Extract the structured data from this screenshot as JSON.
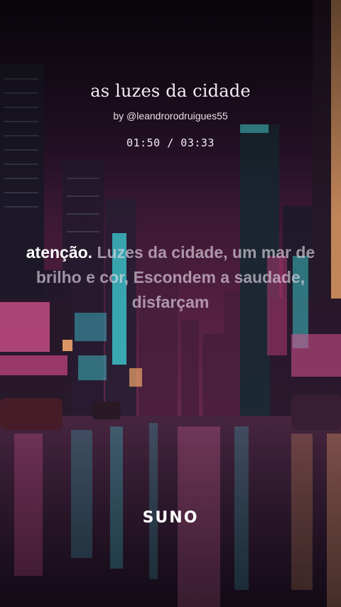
{
  "song": {
    "title": "as luzes da cidade",
    "artist": "by @leandrorodruigues55",
    "time": "01:50 / 03:33"
  },
  "lyrics": {
    "active": "atenção.",
    "upcoming": "Luzes da cidade, um mar de brilho e cor, Escondem a saudade, disfarçam"
  },
  "brand": {
    "logo": "SUNO"
  },
  "colors": {
    "sky_top": "#1a0e1c",
    "sky_mid": "#5e2347",
    "neon_cyan": "#4fd8e0",
    "neon_pink": "#e85a9a",
    "neon_orange": "#ffb070"
  }
}
